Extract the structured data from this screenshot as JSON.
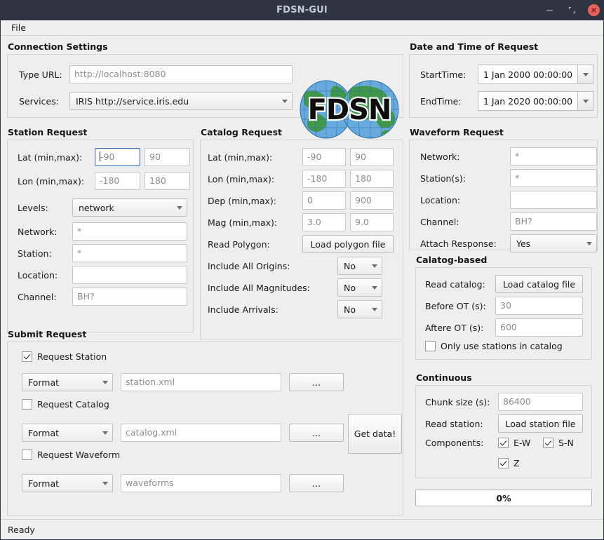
{
  "window": {
    "title": "FDSN-GUI",
    "minimize_icon": "minimize-icon",
    "maximize_icon": "maximize-restore-icon",
    "close_icon": "close-icon"
  },
  "menubar": {
    "items": [
      {
        "label": "File"
      }
    ]
  },
  "statusbar": {
    "text": "Ready"
  },
  "logo": {
    "text": "FDSN",
    "globe_blue": "#5aa0dc",
    "globe_green": "#3f9949"
  },
  "connection": {
    "title": "Connection Settings",
    "url_label": "Type URL:",
    "url_placeholder": "http://localhost:8080",
    "url_value": "",
    "services_label": "Services:",
    "services_value": "IRIS   http://service.iris.edu"
  },
  "datetime": {
    "title": "Date and Time of Request",
    "start_label": "StartTime:",
    "start_value": "1 Jan 2000 00:00:00",
    "end_label": "EndTime:",
    "end_value": "1 Jan 2020 00:00:00"
  },
  "station_request": {
    "title": "Station Request",
    "lat_label": "Lat (min,max):",
    "lat_min": "-90",
    "lat_max": "90",
    "lon_label": "Lon (min,max):",
    "lon_min": "-180",
    "lon_max": "180",
    "levels_label": "Levels:",
    "levels_value": "network",
    "network_label": "Network:",
    "network_value": "*",
    "station_label": "Station:",
    "station_value": "*",
    "location_label": "Location:",
    "location_value": "",
    "channel_label": "Channel:",
    "channel_value": "BH?"
  },
  "catalog_request": {
    "title": "Catalog Request",
    "lat_label": "Lat (min,max):",
    "lat_min": "-90",
    "lat_max": "90",
    "lon_label": "Lon (min,max):",
    "lon_min": "-180",
    "lon_max": "180",
    "dep_label": "Dep (min,max):",
    "dep_min": "0",
    "dep_max": "900",
    "mag_label": "Mag (min,max):",
    "mag_min": "3.0",
    "mag_max": "9.0",
    "polygon_label": "Read Polygon:",
    "polygon_button": "Load polygon file",
    "origins_label": "Include All Origins:",
    "origins_value": "No",
    "magnitudes_label": "Include All Magnitudes:",
    "magnitudes_value": "No",
    "arrivals_label": "Include Arrivals:",
    "arrivals_value": "No"
  },
  "waveform_request": {
    "title": "Waveform Request",
    "network_label": "Network:",
    "network_value": "*",
    "stations_label": "Station(s):",
    "stations_value": "*",
    "location_label": "Location:",
    "location_value": "",
    "channel_label": "Channel:",
    "channel_value": "BH?",
    "attach_label": "Attach Response:",
    "attach_value": "Yes"
  },
  "catalog_based": {
    "title": "Calatog-based",
    "read_label": "Read catalog:",
    "read_button": "Load catalog file",
    "before_label": "Before OT (s):",
    "before_value": "30",
    "after_label": "Aftere OT (s):",
    "after_value": "600",
    "only_stations_label": "Only use stations in catalog",
    "only_stations_checked": false
  },
  "continuous": {
    "title": "Continuous",
    "chunk_label": "Chunk size (s):",
    "chunk_value": "86400",
    "read_station_label": "Read station:",
    "read_station_button": "Load station file",
    "components_label": "Components:",
    "components": [
      {
        "label": "E-W",
        "checked": true
      },
      {
        "label": "S-N",
        "checked": true
      },
      {
        "label": "Z",
        "checked": true
      }
    ],
    "progress_text": "0%",
    "progress_percent": 0
  },
  "submit_request": {
    "title": "Submit Request",
    "station_checkbox": "Request Station",
    "station_checked": true,
    "station_format": "Format",
    "station_file": "station.xml",
    "station_browse": "...",
    "catalog_checkbox": "Request Catalog",
    "catalog_checked": false,
    "catalog_format": "Format",
    "catalog_file": "catalog.xml",
    "catalog_browse": "...",
    "waveform_checkbox": "Request Waveform",
    "waveform_checked": false,
    "waveform_format": "Format",
    "waveform_file": "waveforms",
    "waveform_browse": "...",
    "get_data_button": "Get data!"
  }
}
